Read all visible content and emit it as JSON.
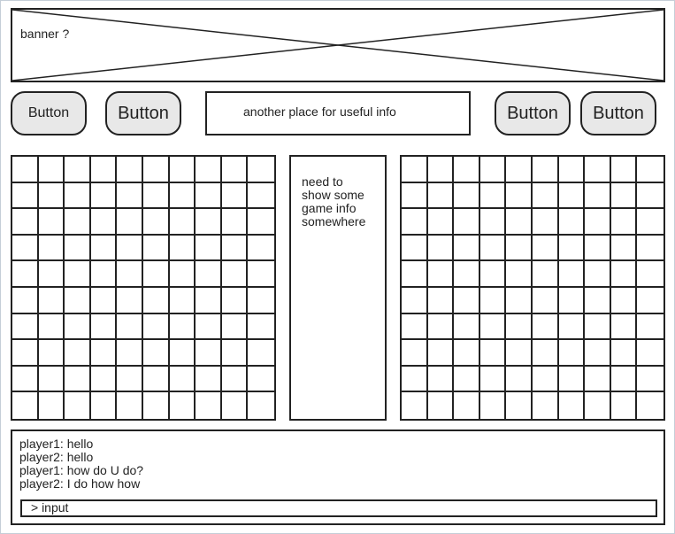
{
  "banner": {
    "label": "banner ?"
  },
  "toolbar": {
    "buttons": [
      "Button",
      "Button",
      "Button",
      "Button"
    ],
    "info": "another place for useful info"
  },
  "game_info": {
    "lines": [
      "need to",
      "show some",
      "game info",
      "somewhere"
    ]
  },
  "boards": {
    "rows": 10,
    "cols": 10
  },
  "chat": {
    "messages": [
      "player1: hello",
      "player2: hello",
      "player1: how do U do?",
      "player2: I do how how"
    ],
    "input": "> input"
  }
}
